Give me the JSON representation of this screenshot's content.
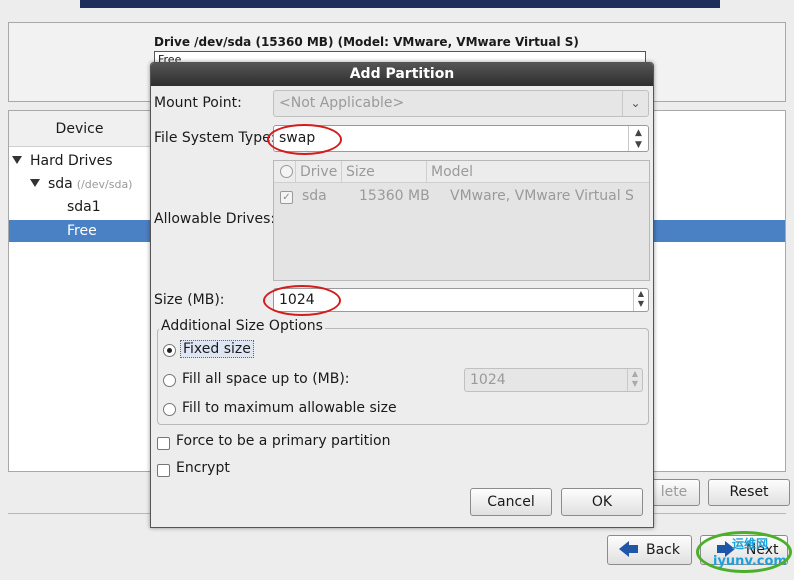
{
  "background": {
    "drive_title": "Drive /dev/sda (15360 MB) (Model: VMware, VMware Virtual S)",
    "drive_bar_label": "Free",
    "device_header": "Device",
    "tree": {
      "hard_drives": "Hard Drives",
      "sda": "sda",
      "sda_path": "(/dev/sda)",
      "sda1": "sda1",
      "free": "Free"
    },
    "buttons": {
      "delete": "lete",
      "reset": "Reset",
      "back": "Back",
      "next": "Next"
    },
    "watermark": {
      "line1": "运维网",
      "line2": "iyunv.com"
    }
  },
  "dialog": {
    "title": "Add Partition",
    "mount_point": {
      "label": "Mount Point:",
      "placeholder": "<Not Applicable>"
    },
    "fs_type": {
      "label": "File System Type:",
      "value": "swap"
    },
    "allowable_drives": {
      "label": "Allowable Drives:",
      "columns": [
        "Drive",
        "Size",
        "Model"
      ],
      "rows": [
        {
          "drive": "sda",
          "size": "15360 MB",
          "model": "VMware, VMware Virtual S",
          "checked": true
        }
      ]
    },
    "size": {
      "label": "Size (MB):",
      "value": "1024"
    },
    "size_options": {
      "title": "Additional Size Options",
      "fixed": "Fixed size",
      "fill_up_to": "Fill all space up to (MB):",
      "fill_up_to_value": "1024",
      "fill_max": "Fill to maximum allowable size",
      "selected": "fixed"
    },
    "force_primary": "Force to be a primary partition",
    "encrypt": "Encrypt",
    "buttons": {
      "cancel": "Cancel",
      "ok": "OK"
    }
  },
  "colors": {
    "selection": "#4a80c4",
    "annotation_red": "#d41c1c",
    "annotation_green": "#4caf2a",
    "dialog_title_bg": "#2e2e2e"
  }
}
